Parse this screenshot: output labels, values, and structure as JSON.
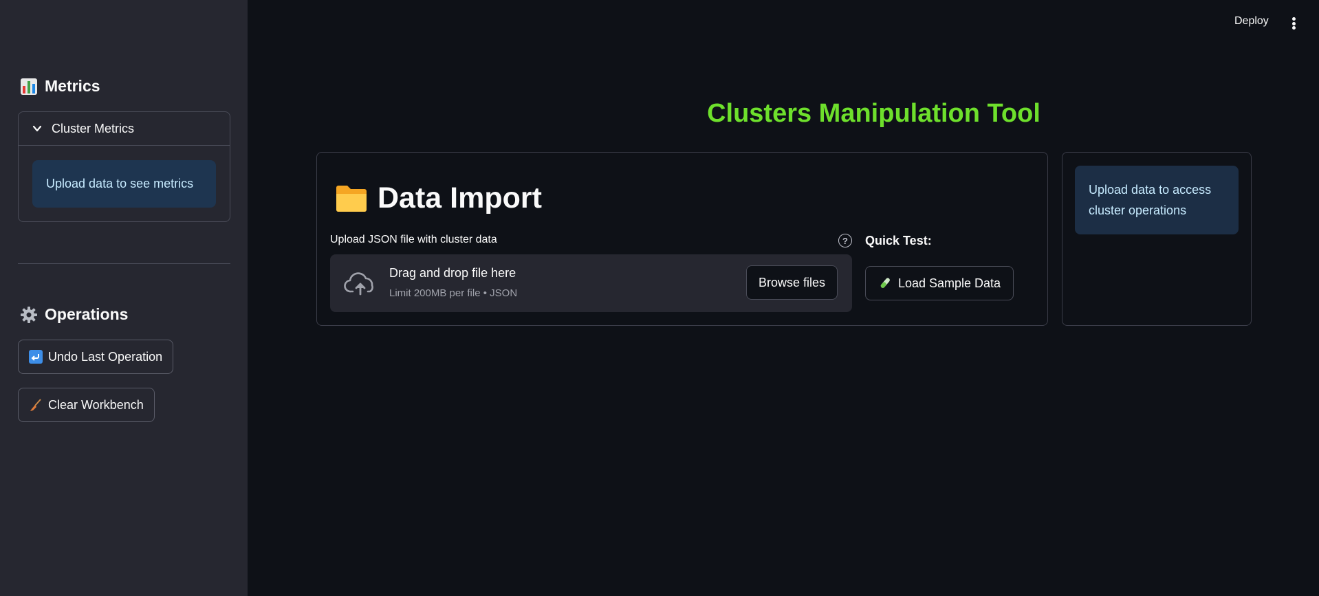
{
  "sidebar": {
    "metrics_heading": "Metrics",
    "expander_title": "Cluster Metrics",
    "metrics_info": "Upload data to see metrics",
    "operations_heading": "Operations",
    "undo_button": "Undo Last Operation",
    "clear_button": "Clear Workbench"
  },
  "header": {
    "deploy_label": "Deploy"
  },
  "main": {
    "title": "Clusters Manipulation Tool",
    "data_import_heading": "Data Import",
    "uploader_label": "Upload JSON file with cluster data",
    "help_glyph": "?",
    "dropzone_title": "Drag and drop file here",
    "dropzone_subtitle": "Limit 200MB per file • JSON",
    "browse_button": "Browse files",
    "quick_test_label": "Quick Test:",
    "load_sample_button": "Load Sample Data",
    "side_info": "Upload data to access cluster operations"
  },
  "colors": {
    "title_green": "#6ee02c",
    "info_blue_bg": "#1e3550",
    "sidebar_bg": "#262730",
    "main_bg": "#0e1117"
  },
  "icons": [
    "bar-chart-icon",
    "chevron-down-icon",
    "gear-icon",
    "undo-arrow-icon",
    "broom-icon",
    "kebab-menu-icon",
    "folder-icon",
    "help-circle-icon",
    "cloud-upload-icon",
    "test-tube-icon"
  ]
}
